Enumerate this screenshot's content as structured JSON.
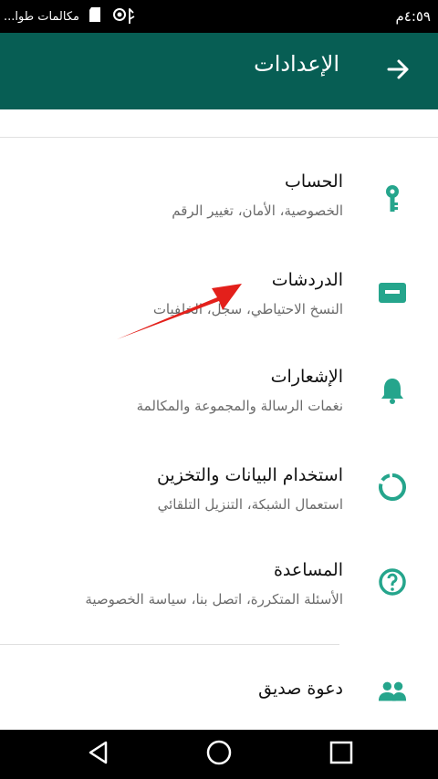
{
  "status_bar": {
    "notification_text": "مكالمات طوا...",
    "time": "٤:٥٩م"
  },
  "app_bar": {
    "title": "الإعدادات"
  },
  "settings": [
    {
      "title": "الحساب",
      "subtitle": "الخصوصية، الأمان، تغيير الرقم",
      "icon": "key-icon"
    },
    {
      "title": "الدردشات",
      "subtitle": "النسخ الاحتياطي، سجل، الخلفيات",
      "icon": "chat-icon"
    },
    {
      "title": "الإشعارات",
      "subtitle": "نغمات الرسالة والمجموعة والمكالمة",
      "icon": "bell-icon"
    },
    {
      "title": "استخدام البيانات والتخزين",
      "subtitle": "استعمال الشبكة، التنزيل التلقائي",
      "icon": "data-usage-icon"
    },
    {
      "title": "المساعدة",
      "subtitle": "الأسئلة المتكررة، اتصل بنا، سياسة الخصوصية",
      "icon": "help-icon"
    }
  ],
  "invite": {
    "title": "دعوة صديق",
    "icon": "people-icon"
  },
  "colors": {
    "appbar": "#075e54",
    "icon_accent": "#25a58c",
    "annotation_arrow": "#e3201b"
  },
  "nav_bar": {
    "back": "back-icon",
    "home": "home-icon",
    "recents": "recents-icon"
  }
}
